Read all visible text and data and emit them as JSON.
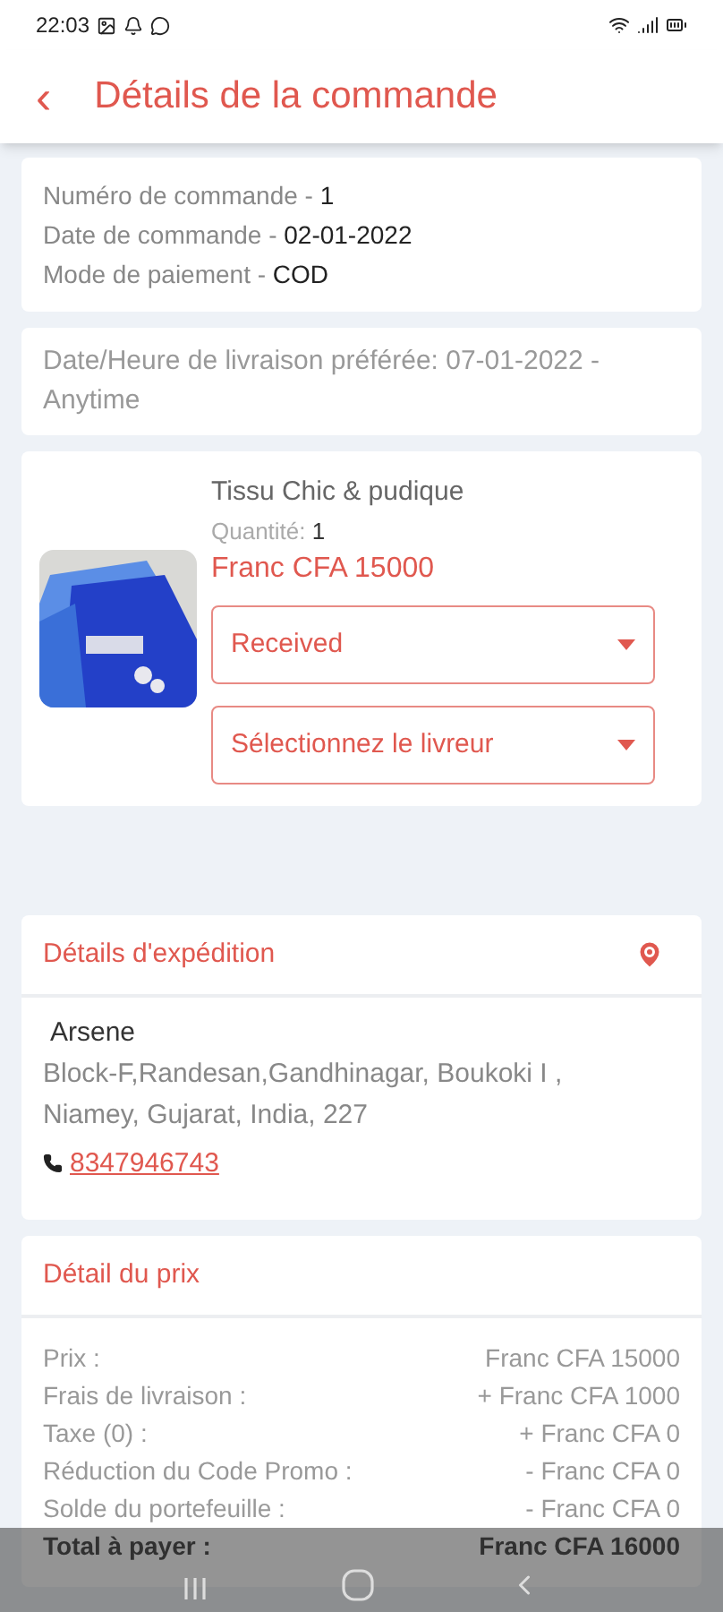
{
  "status_bar": {
    "time": "22:03"
  },
  "header": {
    "back": "‹",
    "title": "Détails de la commande"
  },
  "order_info": [
    {
      "label": "Numéro de commande - ",
      "value": "1"
    },
    {
      "label": "Date de commande - ",
      "value": "02-01-2022"
    },
    {
      "label": "Mode de paiement - ",
      "value": "COD"
    }
  ],
  "delivery_preference": "Date/Heure de livraison préférée: 07-01-2022 - Anytime",
  "product": {
    "name": "Tissu Chic & pudique",
    "quantity_label": "Quantité: ",
    "quantity": "1",
    "price": "Franc CFA 15000",
    "dropdowns": [
      {
        "value": "Received"
      },
      {
        "value": "Sélectionnez le livreur"
      }
    ]
  },
  "shipping": {
    "title": "Détails d'expédition",
    "name": "Arsene",
    "address": "Block-F,Randesan,Gandhinagar, Boukoki I , Niamey, Gujarat, India, 227",
    "phone": "8347946743"
  },
  "price_details": {
    "title": "Détail du prix",
    "rows": [
      {
        "kind": "line",
        "label": "Prix :",
        "value": "Franc CFA 15000"
      },
      {
        "kind": "line",
        "label": "Frais de livraison :",
        "value": "+ Franc CFA 1000"
      },
      {
        "kind": "line",
        "label": "Taxe (0) :",
        "value": "+ Franc CFA 0"
      },
      {
        "kind": "line",
        "label": "Réduction du Code Promo :",
        "value": "- Franc CFA 0"
      },
      {
        "kind": "line",
        "label": "Solde du portefeuille :",
        "value": "- Franc CFA 0"
      },
      {
        "kind": "total",
        "label": "Total à payer :",
        "value": "Franc CFA 16000"
      }
    ]
  }
}
